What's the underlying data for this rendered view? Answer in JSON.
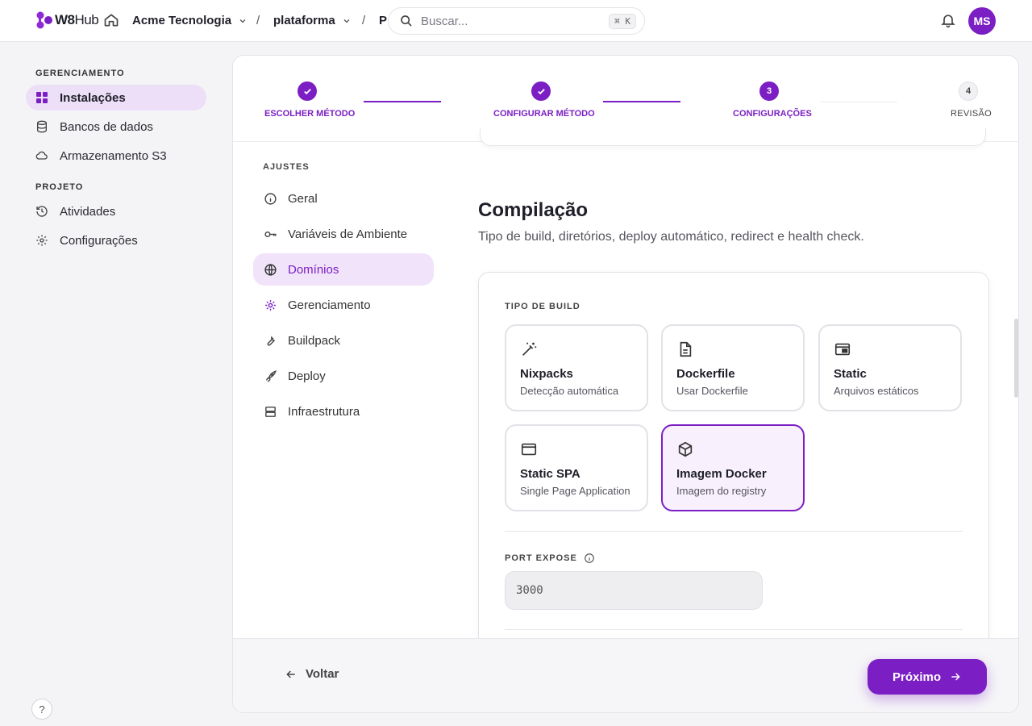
{
  "app": {
    "logo_bold": "W8",
    "logo_light": "Hub"
  },
  "topbar": {
    "org": "Acme Tecnologia",
    "project": "plataforma",
    "truncated_crumb": "P",
    "search_placeholder": "Buscar...",
    "search_shortcut": "⌘ K",
    "avatar_initials": "MS"
  },
  "sidebar": {
    "section_management": "GERENCIAMENTO",
    "items_management": [
      {
        "label": "Instalações",
        "icon": "grid-icon",
        "active": true
      },
      {
        "label": "Bancos de dados",
        "icon": "database-icon"
      },
      {
        "label": "Armazenamento S3",
        "icon": "cloud-icon"
      }
    ],
    "section_project": "PROJETO",
    "items_project": [
      {
        "label": "Atividades",
        "icon": "history-icon"
      },
      {
        "label": "Configurações",
        "icon": "gear-icon"
      }
    ],
    "help": "?"
  },
  "stepper": {
    "steps": [
      {
        "label": "ESCOLHER MÉTODO",
        "state": "done"
      },
      {
        "label": "CONFIGURAR MÉTODO",
        "state": "done"
      },
      {
        "label": "CONFIGURAÇÕES",
        "number": "3",
        "state": "current"
      },
      {
        "label": "REVISÃO",
        "number": "4",
        "state": "todo"
      }
    ]
  },
  "settings_nav": {
    "title": "AJUSTES",
    "items": [
      {
        "label": "Geral",
        "icon": "info-icon"
      },
      {
        "label": "Variáveis de Ambiente",
        "icon": "key-icon"
      },
      {
        "label": "Domínios",
        "icon": "globe-icon",
        "active": true
      },
      {
        "label": "Gerenciamento",
        "icon": "cog-cluster-icon"
      },
      {
        "label": "Buildpack",
        "icon": "wrench-icon"
      },
      {
        "label": "Deploy",
        "icon": "rocket-icon"
      },
      {
        "label": "Infraestrutura",
        "icon": "server-icon"
      }
    ]
  },
  "section": {
    "title": "Compilação",
    "description": "Tipo de build, diretórios, deploy automático, redirect e health check."
  },
  "build": {
    "label": "TIPO DE BUILD",
    "options": [
      {
        "name": "Nixpacks",
        "sub": "Detecção automática",
        "icon": "magic-wand-icon"
      },
      {
        "name": "Dockerfile",
        "sub": "Usar Dockerfile",
        "icon": "file-icon"
      },
      {
        "name": "Static",
        "sub": "Arquivos estáticos",
        "icon": "layout-icon"
      },
      {
        "name": "Static SPA",
        "sub": "Single Page Application",
        "icon": "window-icon"
      },
      {
        "name": "Imagem Docker",
        "sub": "Imagem do registry",
        "icon": "box-icon",
        "selected": true
      }
    ]
  },
  "port": {
    "label": "PORT EXPOSE",
    "value": "3000"
  },
  "footer": {
    "back": "Voltar",
    "next": "Próximo"
  },
  "colors": {
    "accent": "#7b1fc4",
    "accent_soft": "#ecdff7"
  }
}
